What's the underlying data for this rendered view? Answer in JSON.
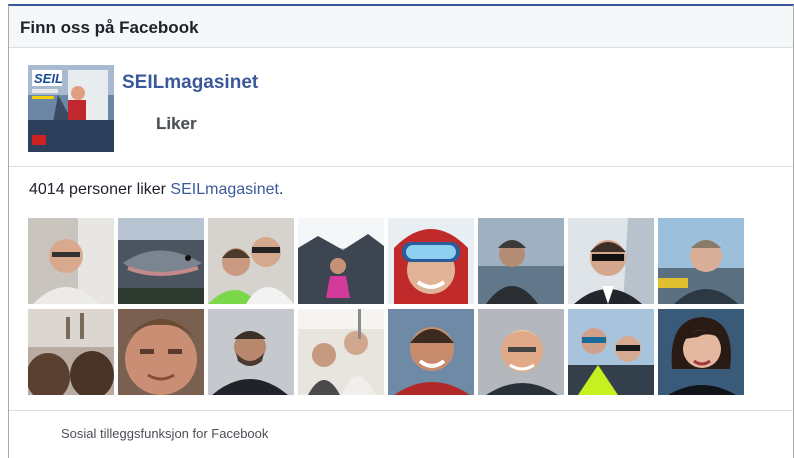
{
  "header": {
    "title": "Finn oss på Facebook"
  },
  "page": {
    "name": "SEILmagasinet",
    "thumbnail_icon": "magazine-cover-thumbnail",
    "like_button_label": "Liker"
  },
  "likes": {
    "count_text": "4014 personer liker ",
    "page_link": "SEILmagasinet",
    "suffix": "."
  },
  "faces": [
    {
      "icon": "face-man-glasses"
    },
    {
      "icon": "fish-photo"
    },
    {
      "icon": "face-two-men"
    },
    {
      "icon": "face-woman-rocks"
    },
    {
      "icon": "face-woman-ski-goggles"
    },
    {
      "icon": "face-man-sea"
    },
    {
      "icon": "face-man-sunglasses"
    },
    {
      "icon": "face-man-harbor"
    },
    {
      "icon": "face-blurry-people"
    },
    {
      "icon": "face-man-closeup"
    },
    {
      "icon": "face-man-beard"
    },
    {
      "icon": "face-men-boat"
    },
    {
      "icon": "face-man-smiling"
    },
    {
      "icon": "face-man-blond"
    },
    {
      "icon": "face-women-sunglasses"
    },
    {
      "icon": "face-woman-portrait"
    }
  ],
  "footer": {
    "text": "Sosial tilleggsfunksjon for Facebook"
  },
  "colors": {
    "brand": "#3b5998",
    "border": "#aaaaaa",
    "header_bg": "#f6f7f8"
  }
}
